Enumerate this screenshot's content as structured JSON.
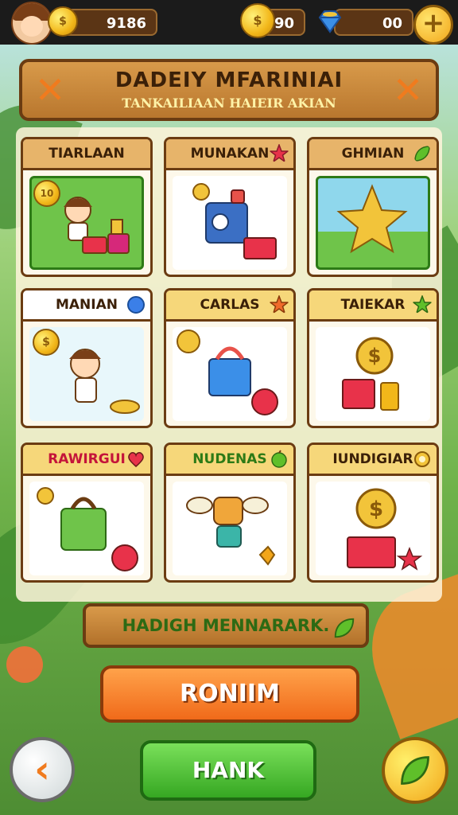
{
  "topbar": {
    "coins_a": "9186",
    "coins_b": "90",
    "gems": "00"
  },
  "header": {
    "title": "DADEIY MFARINIAI",
    "subtitle": "TANKAILIAAN HAIEIR AKIAN"
  },
  "cards": [
    {
      "label": "TIARLAAN",
      "badge": "10",
      "tag": "none",
      "bg": "#6fc44a"
    },
    {
      "label": "MUNAKAN",
      "tag": "star",
      "tag_color": "#e8324a",
      "bg": "#ffffff"
    },
    {
      "label": "GHMIAN",
      "tag": "leaf",
      "tag_color": "#5fbf2a",
      "bg": "#8fd7ec"
    },
    {
      "label": "MANIAN",
      "tag": "gem",
      "tag_color": "#3b7fe8",
      "bg": "#e8f7fb"
    },
    {
      "label": "CARLAS",
      "tag": "star",
      "tag_color": "#f06a2a",
      "bg": "#ffffff"
    },
    {
      "label": "TAIEKAR",
      "tag": "star",
      "tag_color": "#5fbf2a",
      "bg": "#ffffff"
    },
    {
      "label": "RAWIRGUI",
      "tag": "heart",
      "tag_color": "#e8324a",
      "bg": "#ffffff"
    },
    {
      "label": "NUDENAS",
      "tag": "apple",
      "tag_color": "#5fbf2a",
      "bg": "#ffffff"
    },
    {
      "label": "IUNDIGIAR",
      "tag": "gear",
      "tag_color": "#f2b71a",
      "bg": "#ffffff"
    }
  ],
  "banner": {
    "label": "HADIGH MENNARARK."
  },
  "buttons": {
    "primary": "RONIIM",
    "secondary": "HANK"
  }
}
